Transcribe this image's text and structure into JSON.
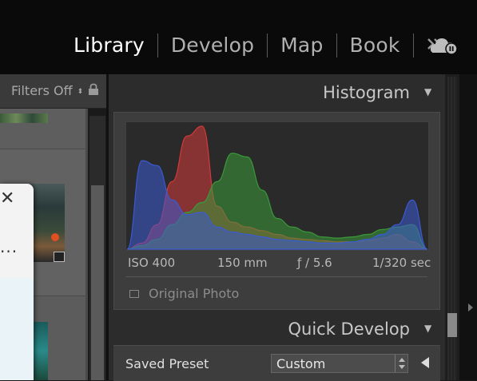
{
  "modules": {
    "library": "Library",
    "develop": "Develop",
    "map": "Map",
    "book": "Book",
    "more_icon": "double-chevron-icon",
    "cloud_icon": "cloud-sync-paused-icon"
  },
  "left_panel": {
    "filters_label": "Filters Off",
    "lock_icon": "lock-icon",
    "popup_close": "✕",
    "popup_more": "..."
  },
  "histogram": {
    "title": "Histogram",
    "iso": "ISO 400",
    "focal": "150 mm",
    "aperture": "ƒ / 5.6",
    "shutter": "1/320 sec",
    "original_photo_label": "Original Photo",
    "chart_data": {
      "type": "area",
      "x": [
        0,
        5,
        10,
        15,
        20,
        25,
        30,
        35,
        40,
        45,
        50,
        55,
        60,
        65,
        70,
        75,
        80,
        85,
        90,
        95,
        100
      ],
      "series": [
        {
          "color": "#d43a3a",
          "values": [
            0,
            5,
            20,
            55,
            92,
            100,
            35,
            22,
            18,
            15,
            12,
            9,
            8,
            7,
            6,
            6,
            7,
            9,
            12,
            6,
            0
          ]
        },
        {
          "color": "#3a9a3a",
          "values": [
            0,
            3,
            8,
            20,
            30,
            38,
            55,
            78,
            75,
            48,
            25,
            18,
            14,
            10,
            9,
            10,
            12,
            16,
            18,
            20,
            0
          ]
        },
        {
          "color": "#3a5ad4",
          "values": [
            0,
            72,
            68,
            40,
            28,
            30,
            18,
            14,
            12,
            10,
            8,
            7,
            6,
            5,
            5,
            6,
            8,
            12,
            20,
            40,
            0
          ]
        }
      ]
    }
  },
  "quick_develop": {
    "title": "Quick Develop",
    "saved_preset_label": "Saved Preset",
    "saved_preset_value": "Custom"
  },
  "colors": {
    "background": "#1a1a1a",
    "panel": "#2c2c2c",
    "panel_inner": "#3d3d3d",
    "active_module": "#ffffff",
    "inactive_module": "#b0b0b0"
  }
}
